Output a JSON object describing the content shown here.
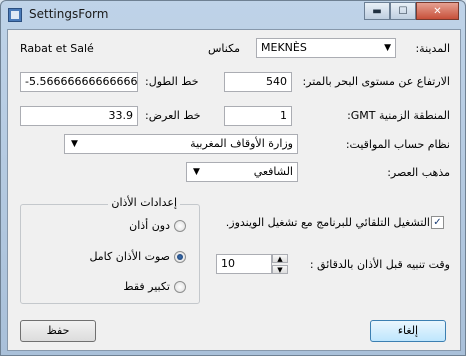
{
  "window": {
    "title": "SettingsForm",
    "controls": {
      "minimize": "▬",
      "maximize": "☐",
      "close": "✕"
    }
  },
  "city": {
    "label": "المدينة:",
    "value": "MEKNÈS",
    "arabic_name": "مكناس",
    "region": "Rabat et Salé"
  },
  "altitude": {
    "label": "الارتفاع عن مستوى البحر بالمتر:",
    "value": "540"
  },
  "longitude": {
    "label": "خط الطول:",
    "value": "-5.5666666666666664"
  },
  "timezone": {
    "label": "المنطقة الزمنية GMT:",
    "value": "1"
  },
  "latitude": {
    "label": "خط العرض:",
    "value": "33.9"
  },
  "calc_method": {
    "label": "نظام حساب المواقيت:",
    "value": "وزارة الأوقاف المغربية"
  },
  "asr_method": {
    "label": "مذهب العصر:",
    "value": "الشافعي"
  },
  "adhan": {
    "group_label": "إعدادات الأذان",
    "options": [
      {
        "label": "دون أذان",
        "checked": false
      },
      {
        "label": "صوت الأذان كامل",
        "checked": true
      },
      {
        "label": "تكبير فقط",
        "checked": false
      }
    ]
  },
  "autostart": {
    "label": "التشغيل التلقائي للبرنامج مع تشغيل الويندوز.",
    "checked": true,
    "mark": "✓"
  },
  "reminder": {
    "label": "وقت تنبيه قبل الأذان بالدقائق :",
    "value": "10"
  },
  "buttons": {
    "save": "حفظ",
    "cancel": "إلغاء"
  },
  "icons": {
    "dropdown": "▼",
    "spin_up": "▲",
    "spin_down": "▼"
  },
  "colors": {
    "title_bar": "#b3c9e0",
    "close_button": "#c7503a",
    "dialog_bg": "#f0f0f0"
  }
}
